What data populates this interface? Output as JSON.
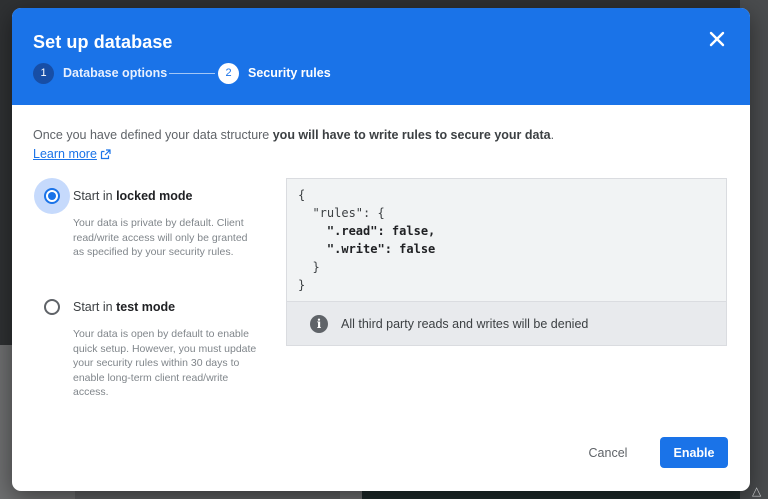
{
  "dialog": {
    "title": "Set up database",
    "steps": [
      {
        "number": "1",
        "label": "Database options"
      },
      {
        "number": "2",
        "label": "Security rules"
      }
    ]
  },
  "intro": {
    "text": "Once you have defined your data structure ",
    "bold": "you will have to write rules to secure your data",
    "end": ".",
    "learn_more": "Learn more"
  },
  "options": [
    {
      "prefix": "Start in ",
      "mode": "locked mode",
      "selected": true,
      "description": "Your data is private by default. Client read/write access will only be granted as specified by your security rules."
    },
    {
      "prefix": "Start in ",
      "mode": "test mode",
      "selected": false,
      "description": "Your data is open by default to enable quick setup. However, you must update your security rules within 30 days to enable long-term client read/write access."
    }
  ],
  "rules": {
    "lines": [
      "{",
      "  \"rules\": {",
      "    \".read\": false,",
      "    \".write\": false",
      "  }",
      "}"
    ],
    "info": "All third party reads and writes will be denied"
  },
  "footer": {
    "cancel": "Cancel",
    "enable": "Enable"
  },
  "colors": {
    "accent": "#1a73e8",
    "header": "#1a73e8"
  }
}
